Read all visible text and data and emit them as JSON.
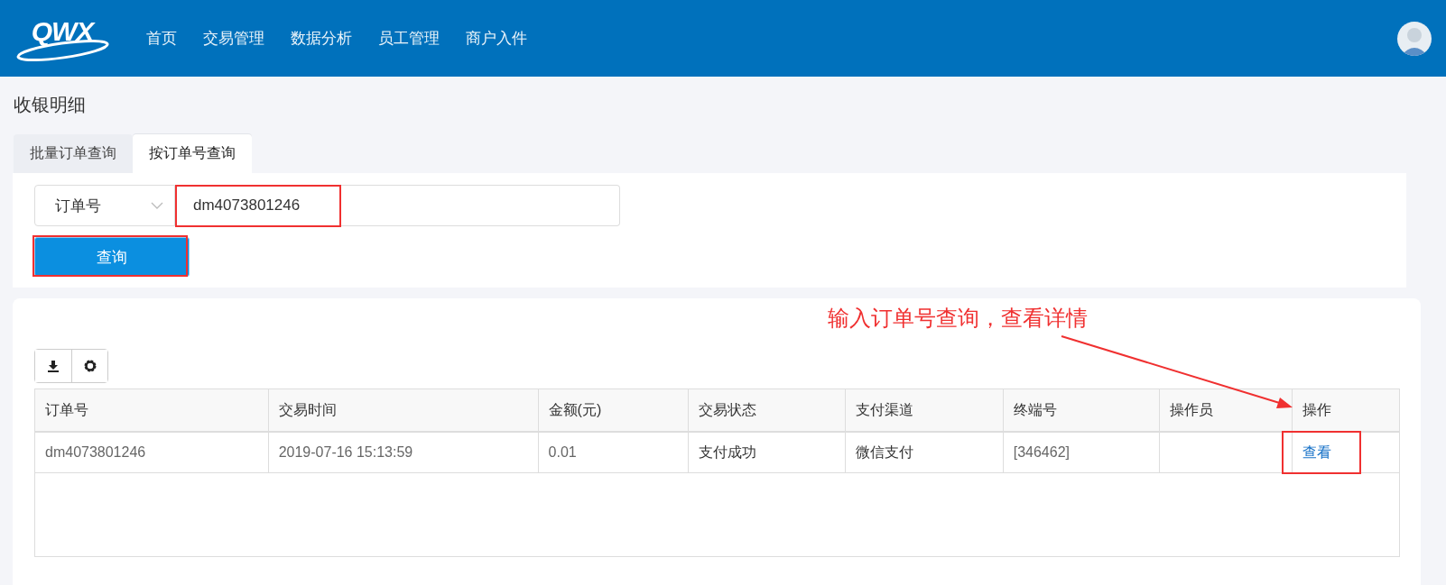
{
  "header": {
    "logo": "QWX",
    "nav": [
      {
        "label": "首页",
        "selected": false
      },
      {
        "label": "交易管理",
        "selected": false
      },
      {
        "label": "数据分析",
        "selected": false
      },
      {
        "label": "员工管理",
        "selected": false
      },
      {
        "label": "商户入件",
        "selected": false
      }
    ]
  },
  "page_title": "收银明细",
  "tabs": [
    {
      "label": "批量订单查询",
      "selected": false
    },
    {
      "label": "按订单号查询",
      "selected": true
    }
  ],
  "search": {
    "select": "订单号",
    "value": "dm4073801246",
    "button": "查询"
  },
  "annotation": "输入订单号查询，查看详情",
  "table": {
    "columns": [
      "订单号",
      "交易时间",
      "金额(元)",
      "交易状态",
      "支付渠道",
      "终端号",
      "操作员",
      "操作"
    ],
    "rows": [
      {
        "cells": [
          "dm4073801246",
          "2019-07-16 15:13:59",
          "0.01",
          "支付成功",
          "微信支付",
          "[346462]",
          ""
        ],
        "action": "查看"
      }
    ]
  }
}
